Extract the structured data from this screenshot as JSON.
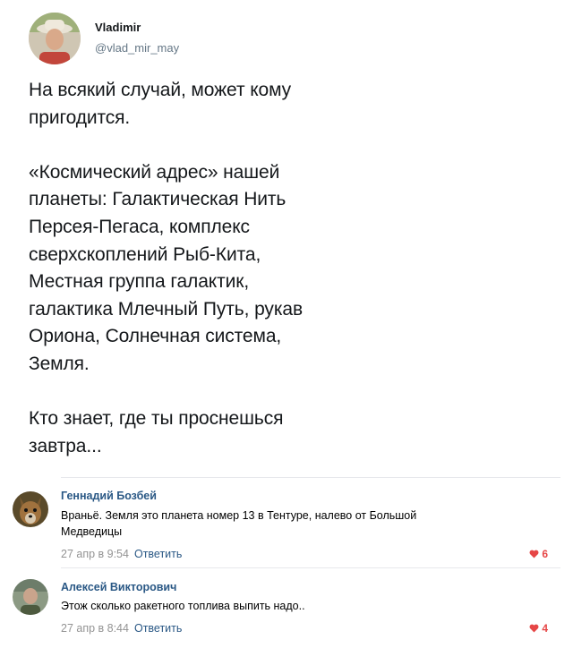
{
  "tweet": {
    "author_name": "Vladimir",
    "author_handle": "@vlad_mir_may",
    "lines_block1": [
      "На всякий случай, может кому",
      "пригодится."
    ],
    "lines_block2": [
      "«Космический адрес» нашей",
      "планеты: Галактическая Нить",
      "Персея-Пегаса, комплекс",
      "сверхскоплений Рыб-Кита,",
      "Местная группа галактик,",
      "галактика Млечный Путь, рукав",
      "Ориона, Солнечная система,",
      "Земля."
    ],
    "lines_block3": [
      "Кто знает, где ты проснешься",
      "завтра..."
    ]
  },
  "comments": [
    {
      "author": "Геннадий Бозбей",
      "text_lines": [
        "Враньё. Земля это планета номер 13 в Тентуре, налево от Большой",
        "Медведицы"
      ],
      "date": "27 апр в 9:54",
      "reply_label": "Ответить",
      "likes": "6"
    },
    {
      "author": "Алексей Викторович",
      "text_lines": [
        "Этож сколько ракетного топлива выпить надо.."
      ],
      "date": "27 апр в 8:44",
      "reply_label": "Ответить",
      "likes": "4"
    }
  ],
  "colors": {
    "link": "#2a5885",
    "like": "#e64646",
    "muted": "#939393"
  }
}
